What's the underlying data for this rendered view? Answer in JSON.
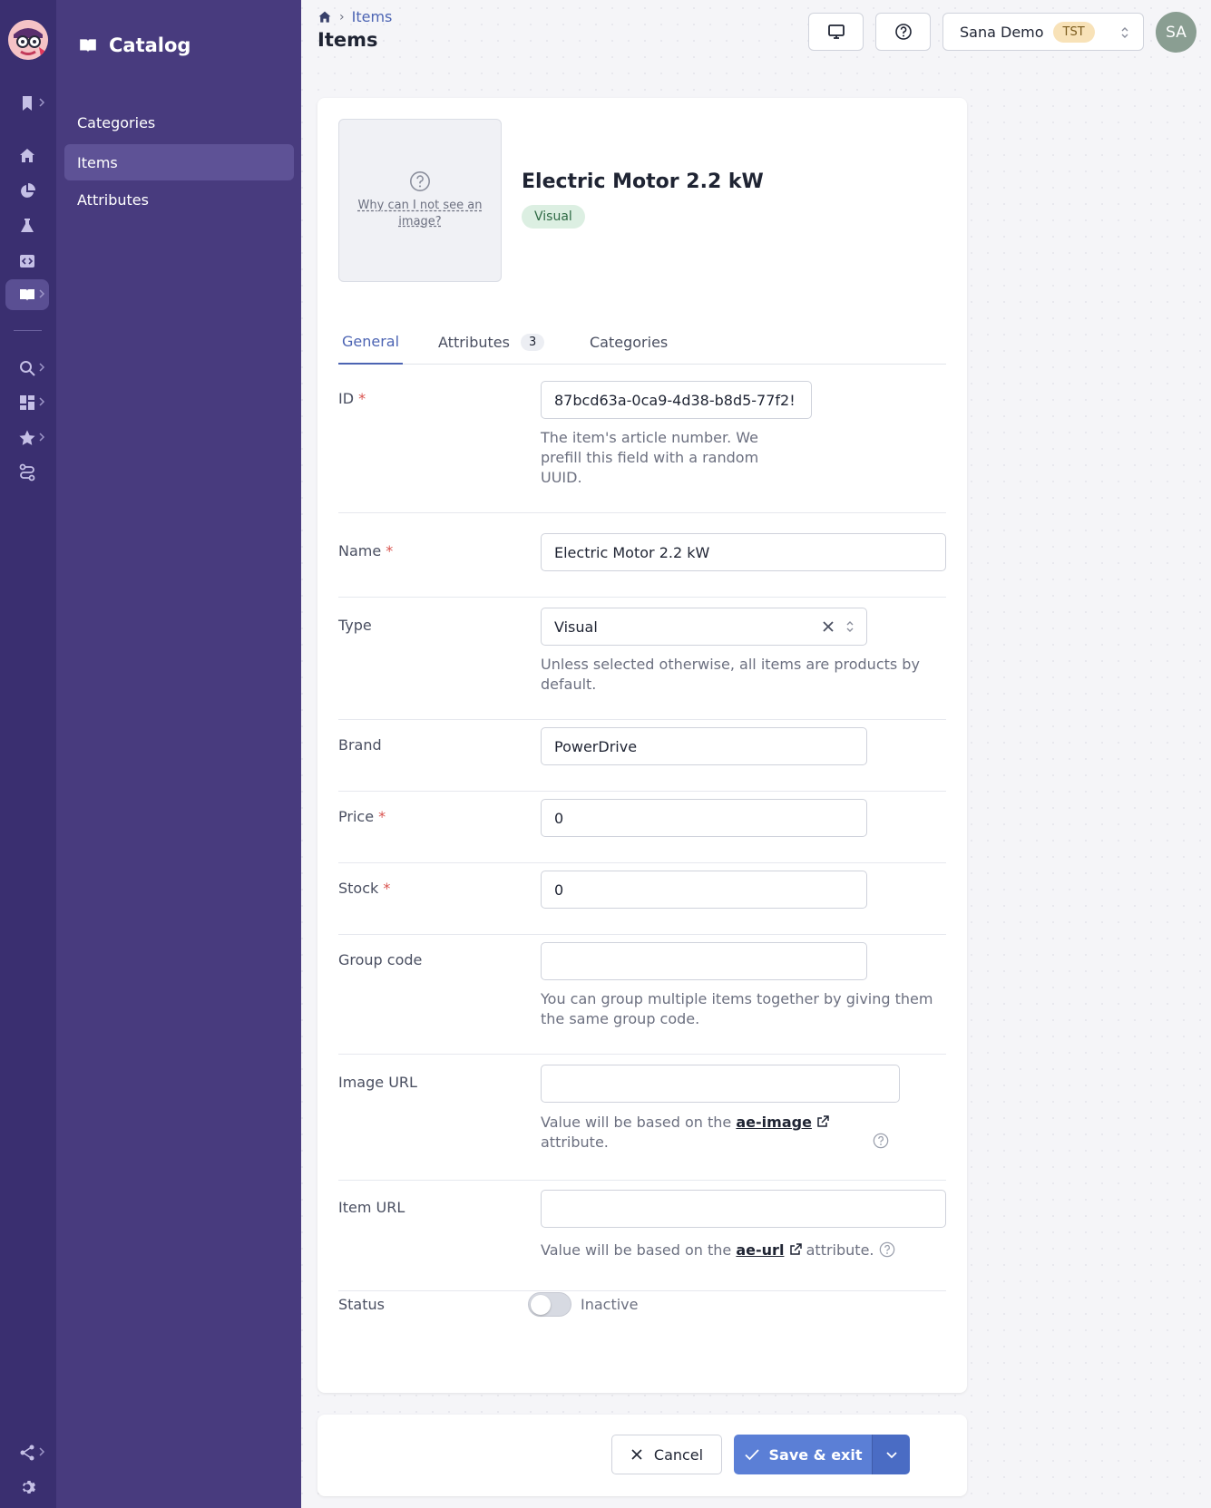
{
  "app": {
    "section_title": "Catalog",
    "nav": [
      {
        "label": "Categories"
      },
      {
        "label": "Items"
      },
      {
        "label": "Attributes"
      }
    ]
  },
  "header": {
    "breadcrumb": [
      "Items"
    ],
    "page_title": "Items",
    "environment": {
      "name": "Sana Demo",
      "badge": "TST"
    },
    "avatar_initials": "SA"
  },
  "item": {
    "title": "Electric Motor 2.2 kW",
    "type_pill": "Visual",
    "image_hint": "Why can I not see an image?"
  },
  "tabs": [
    {
      "label": "General",
      "active": true
    },
    {
      "label": "Attributes",
      "count": "3"
    },
    {
      "label": "Categories"
    }
  ],
  "form": {
    "id": {
      "label": "ID",
      "value": "87bcd63a-0ca9-4d38-b8d5-77f2!",
      "help": "The item's article number. We prefill this field with a random UUID."
    },
    "name": {
      "label": "Name",
      "value": "Electric Motor 2.2 kW"
    },
    "type": {
      "label": "Type",
      "value": "Visual",
      "help": "Unless selected otherwise, all items are products by default."
    },
    "brand": {
      "label": "Brand",
      "value": "PowerDrive"
    },
    "price": {
      "label": "Price",
      "value": "0"
    },
    "stock": {
      "label": "Stock",
      "value": "0"
    },
    "group_code": {
      "label": "Group code",
      "value": "",
      "help": "You can group multiple items together by giving them the same group code."
    },
    "image_url": {
      "label": "Image URL",
      "value": "",
      "help_prefix": "Value will be based on the",
      "help_link": "ae-image",
      "help_suffix": "attribute."
    },
    "item_url": {
      "label": "Item URL",
      "value": "",
      "help_prefix": "Value will be based on the",
      "help_link": "ae-url",
      "help_suffix": "attribute."
    },
    "status": {
      "label": "Status",
      "value": "Inactive",
      "on": false
    }
  },
  "footer": {
    "cancel_label": "Cancel",
    "save_label": "Save & exit"
  },
  "colors": {
    "rail": "#3a2f70",
    "sidebar": "#483b7e",
    "accent": "#4c64b3",
    "primary_button": "#5b7fd6",
    "required": "#d9534f"
  }
}
